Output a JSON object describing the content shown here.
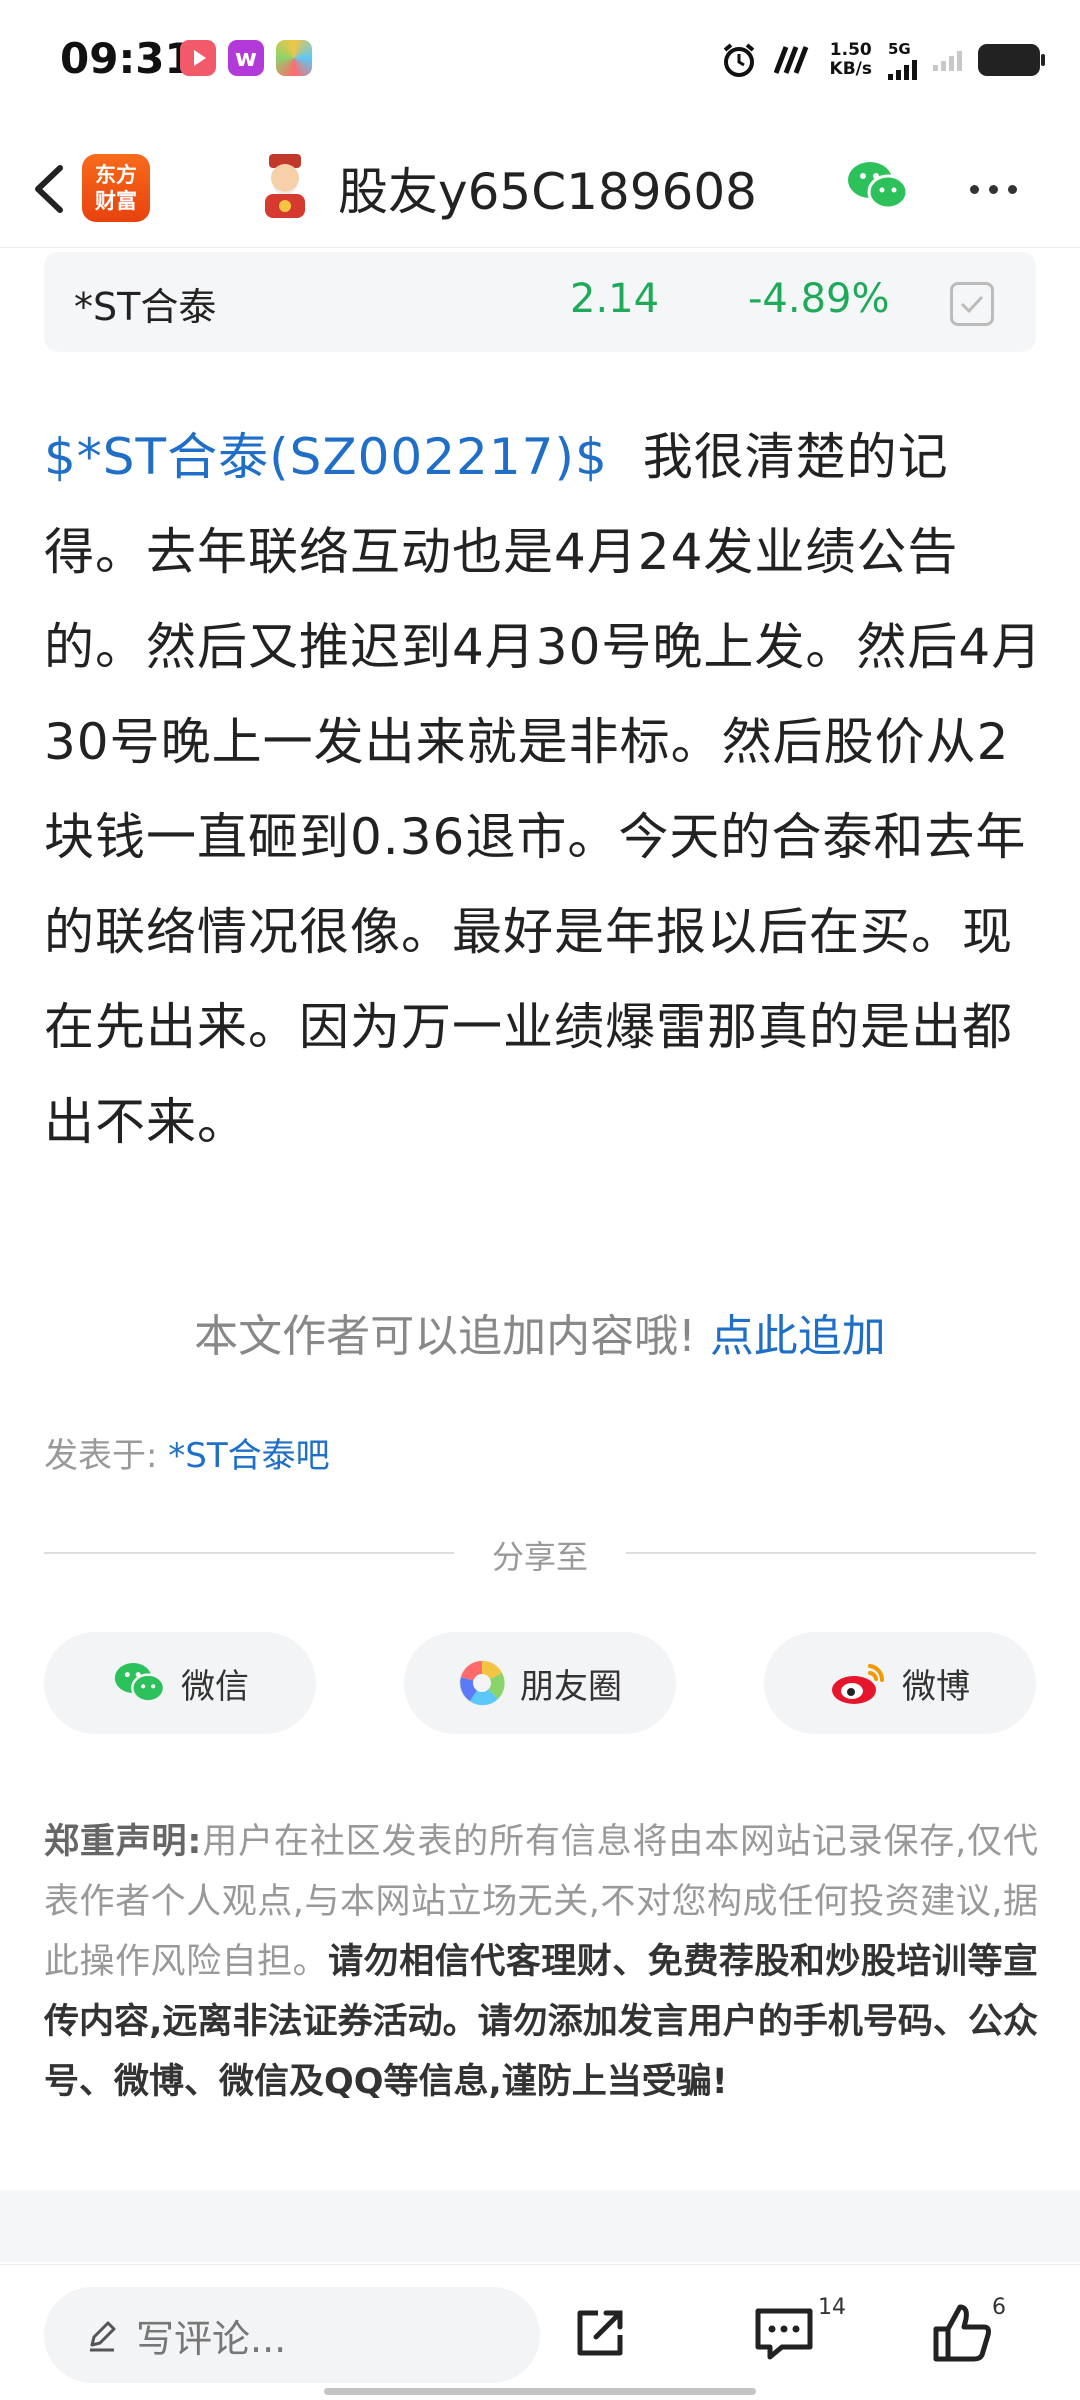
{
  "status_bar": {
    "time": "09:31",
    "net_speed_value": "1.50",
    "net_speed_unit": "KB/s",
    "network": "5G",
    "app_icons": [
      "video-app-icon",
      "w-app-icon",
      "game-app-icon"
    ]
  },
  "header": {
    "logo_line1": "东方",
    "logo_line2": "财富",
    "user_name": "股友y65C189608",
    "brand_color": "#f0531a"
  },
  "stock": {
    "name": "*ST合泰",
    "price": "2.14",
    "change": "-4.89%",
    "down_color": "#1faa59"
  },
  "post": {
    "ticker": "$*ST合泰(SZ002217)$",
    "body": "我很清楚的记得。去年联络互动也是4月24发业绩公告的。然后又推迟到4月30号晚上发。然后4月30号晚上一发出来就是非标。然后股价从2块钱一直砸到0.36退市。今天的合泰和去年的联络情况很像。最好是年报以后在买。现在先出来。因为万一业绩爆雷那真的是出都出不来。"
  },
  "append": {
    "prompt": "本文作者可以追加内容哦!",
    "link": "点此追加"
  },
  "posted_in": {
    "label": "发表于:",
    "forum": "*ST合泰吧"
  },
  "share": {
    "title": "分享至",
    "buttons": [
      {
        "label": "微信",
        "icon": "wechat-icon"
      },
      {
        "label": "朋友圈",
        "icon": "moments-icon"
      },
      {
        "label": "微博",
        "icon": "weibo-icon"
      }
    ]
  },
  "disclaimer": {
    "title": "郑重声明:",
    "normal": "用户在社区发表的所有信息将由本网站记录保存,仅代表作者个人观点,与本网站立场无关,不对您构成任何投资建议,据此操作风险自担。",
    "emphasis": "请勿相信代客理财、免费荐股和炒股培训等宣传内容,远离非法证券活动。请勿添加发言用户的手机号码、公众号、微博、微信及QQ等信息,谨防上当受骗!"
  },
  "bottom_bar": {
    "comment_placeholder": "写评论...",
    "comment_count": "14",
    "like_count": "6"
  },
  "link_color": "#1f6fc8"
}
